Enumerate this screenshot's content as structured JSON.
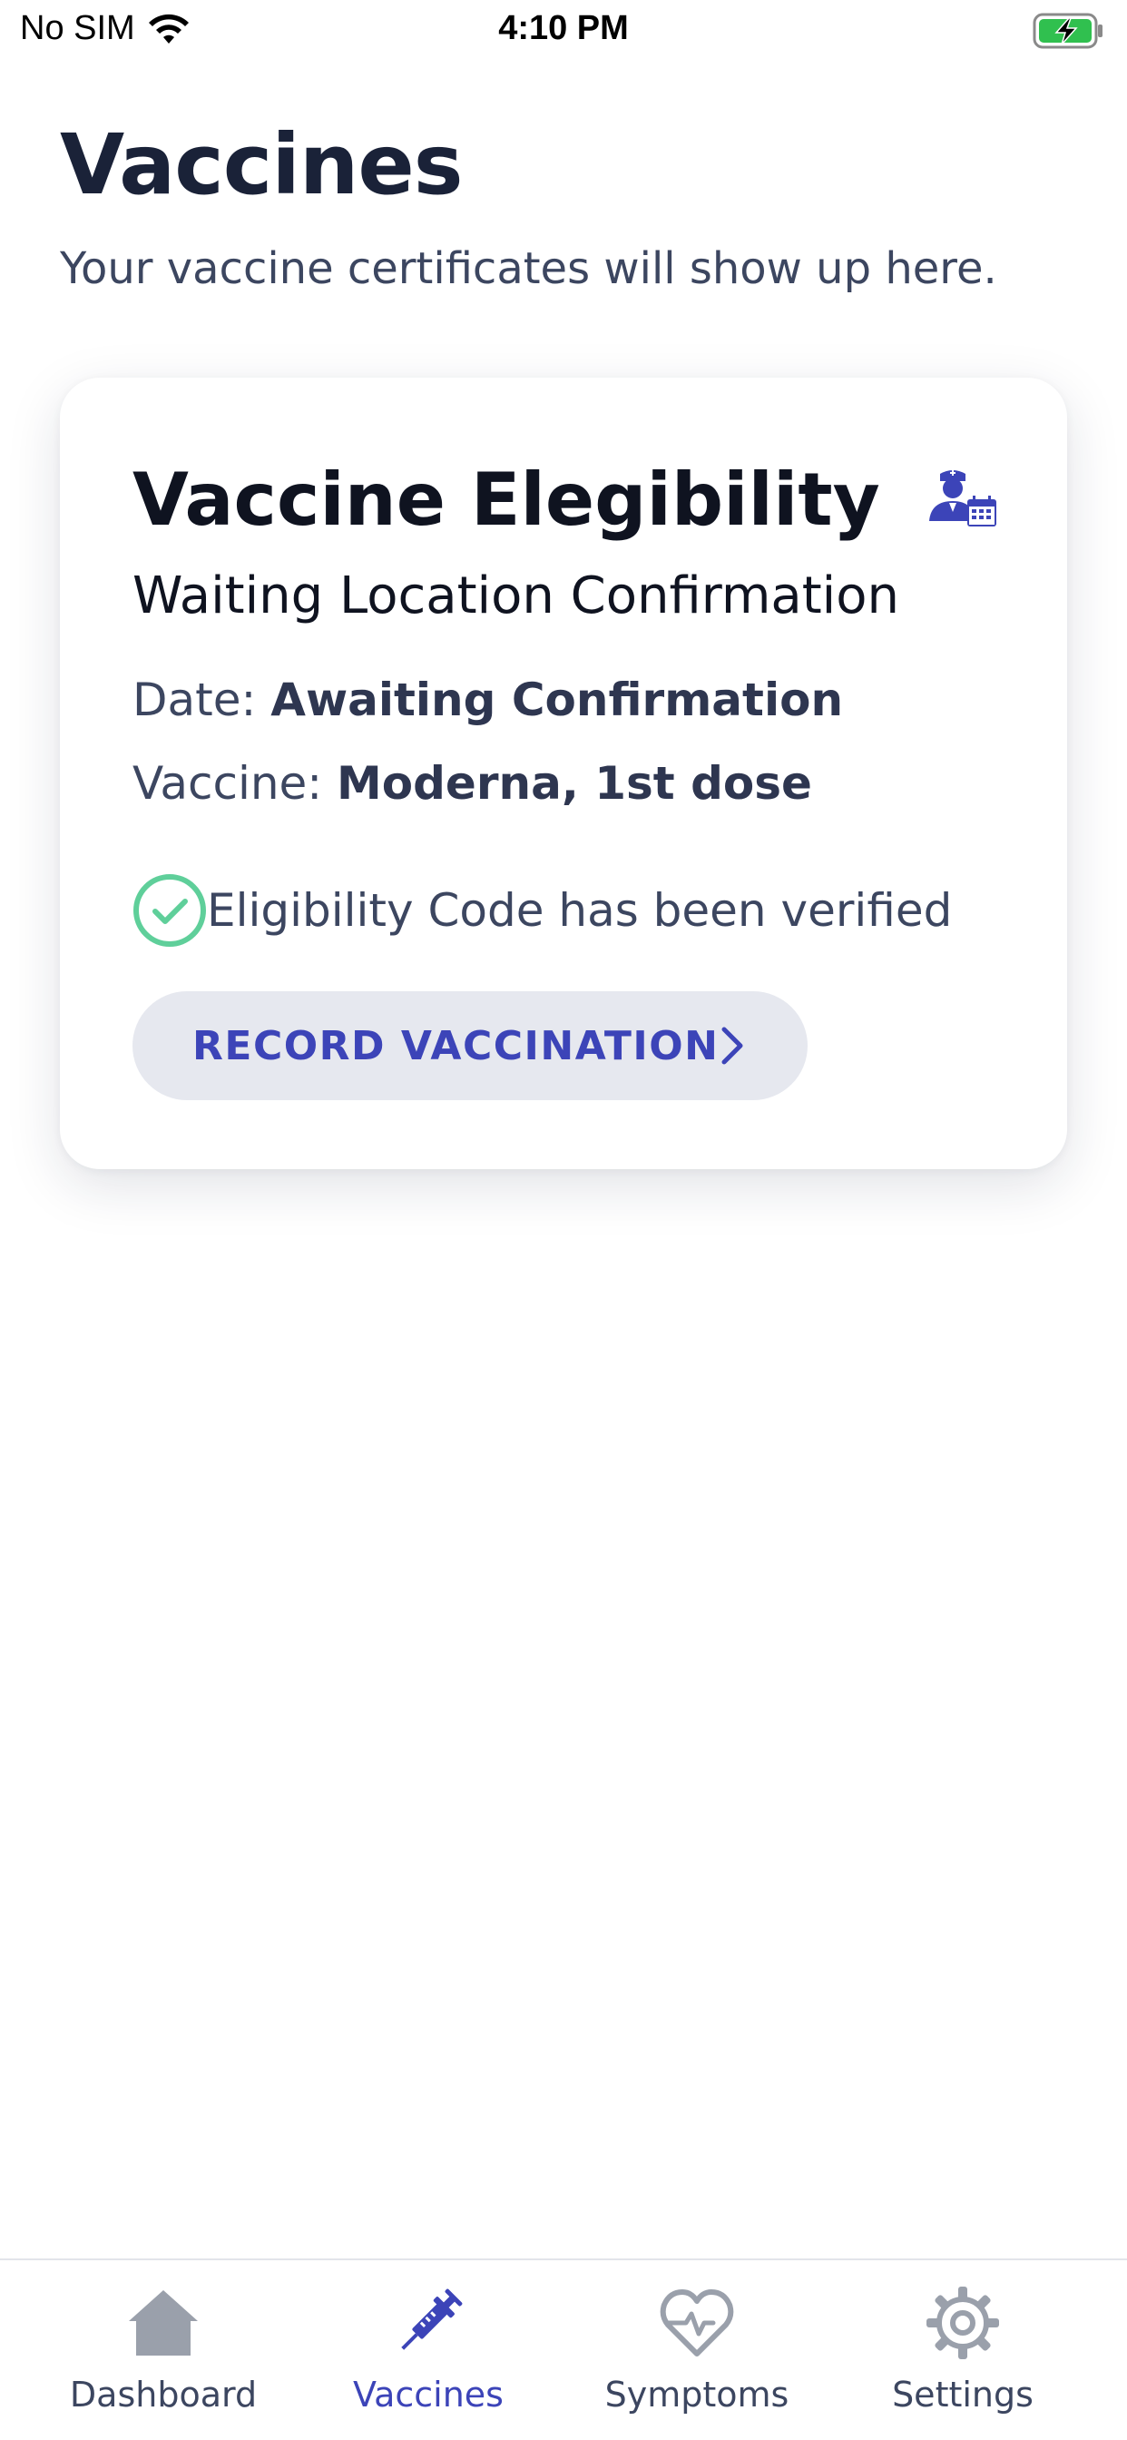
{
  "status_bar": {
    "carrier": "No SIM",
    "time": "4:10 PM",
    "battery_color": "#30c04f"
  },
  "header": {
    "title": "Vaccines",
    "subtitle": "Your vaccine certificates will show up here."
  },
  "card": {
    "title": "Vaccine Elegibility",
    "status": "Waiting Location Confirmation",
    "date_label": "Date: ",
    "date_value": "Awaiting Confirmation",
    "vaccine_label": "Vaccine: ",
    "vaccine_value": "Moderna, 1st dose",
    "verified_text": "Eligibility Code has been verified",
    "button_label": "RECORD VACCINATION",
    "icon": "doctor-calendar-icon"
  },
  "tabs": [
    {
      "label": "Dashboard",
      "icon": "home-icon",
      "active": false
    },
    {
      "label": "Vaccines",
      "icon": "syringe-icon",
      "active": true
    },
    {
      "label": "Symptoms",
      "icon": "heart-pulse-icon",
      "active": false
    },
    {
      "label": "Settings",
      "icon": "gear-icon",
      "active": false
    }
  ],
  "colors": {
    "accent": "#3c44b8",
    "success": "#5fcf9a",
    "inactive_icon": "#9aa0ab"
  }
}
